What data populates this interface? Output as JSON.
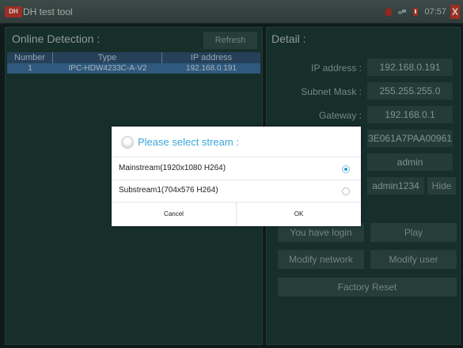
{
  "app": {
    "title": "DH test tool",
    "logo_text": "DH"
  },
  "status": {
    "time": "07:57",
    "close": "X"
  },
  "online": {
    "header": "Online Detection :",
    "refresh_label": "Refresh",
    "columns": [
      "Number",
      "Type",
      "IP address"
    ],
    "rows": [
      {
        "number": "1",
        "type": "IPC-HDW4233C-A-V2",
        "ip": "192.168.0.191"
      }
    ]
  },
  "detail": {
    "header": "Detail :",
    "ip_label": "IP address :",
    "ip_value": "192.168.0.191",
    "mask_label": "Subnet Mask :",
    "mask_value": "255.255.255.0",
    "gateway_label": "Gateway :",
    "gateway_value": "192.168.0.1",
    "serial_value": "3E061A7PAA00961",
    "user_value": "admin",
    "password_value": "admin1234",
    "hide_label": "Hide",
    "login_label": "You have login",
    "play_label": "Play",
    "modify_network_label": "Modify network",
    "modify_user_label": "Modify user",
    "factory_reset_label": "Factory Reset"
  },
  "dialog": {
    "title": "Please select stream :",
    "options": [
      {
        "label": "Mainstream(1920x1080 H264)",
        "selected": true
      },
      {
        "label": "Substream1(704x576 H264)",
        "selected": false
      }
    ],
    "cancel_label": "Cancel",
    "ok_label": "OK"
  },
  "colors": {
    "accent": "#3aa7d9",
    "close_red": "#c0392b",
    "panel": "#1d3a35",
    "table_row": "#3a6d9a"
  }
}
